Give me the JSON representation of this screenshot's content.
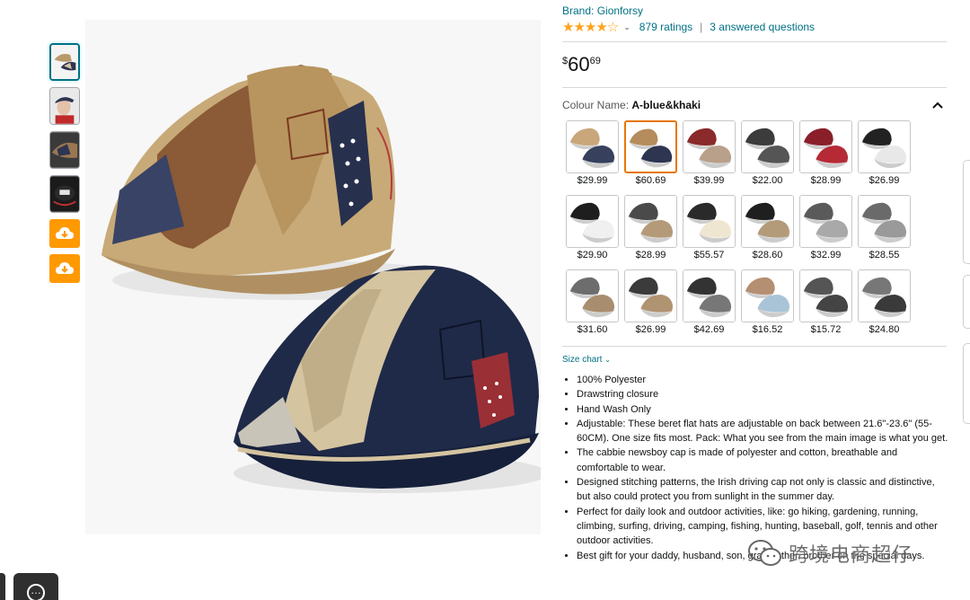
{
  "thumbnails": [
    {
      "icon": "cap-pair-thumbnail",
      "selected": true
    },
    {
      "icon": "model-wearing-cap-thumbnail"
    },
    {
      "icon": "cap-detail-thumbnail"
    },
    {
      "icon": "cap-inner-label-thumbnail"
    }
  ],
  "download_buttons": [
    {
      "icon": "cloud-download-icon"
    },
    {
      "icon": "cloud-download-icon"
    }
  ],
  "brand": "Brand: Gionforsy",
  "rating": {
    "stars": "★★★★☆",
    "ratings": "879 ratings",
    "separator": "|",
    "questions": "3 answered questions"
  },
  "price": {
    "symbol": "$",
    "whole": "60",
    "fraction": "69"
  },
  "colour": {
    "label": "Colour Name: ",
    "value": "A-blue&khaki"
  },
  "swatches": [
    {
      "price": "$29.99",
      "colors": [
        "#c9a77b",
        "#37405c"
      ]
    },
    {
      "price": "$60.69",
      "colors": [
        "#b58d5c",
        "#2d3550"
      ],
      "selected": true
    },
    {
      "price": "$39.99",
      "colors": [
        "#8a2a2a",
        "#b8a08a"
      ]
    },
    {
      "price": "$22.00",
      "colors": [
        "#3c3c3c",
        "#555555"
      ]
    },
    {
      "price": "$28.99",
      "colors": [
        "#8a1f2a",
        "#b52a35"
      ]
    },
    {
      "price": "$26.99",
      "colors": [
        "#222222",
        "#e8e8e8"
      ]
    },
    {
      "price": "$29.90",
      "colors": [
        "#1e1e1e",
        "#f0f0f0"
      ]
    },
    {
      "price": "$28.99",
      "colors": [
        "#4a4a4a",
        "#b49a78"
      ]
    },
    {
      "price": "$55.57",
      "colors": [
        "#2a2a2a",
        "#efe6d2"
      ]
    },
    {
      "price": "$28.60",
      "colors": [
        "#1f1f1f",
        "#b39b7a"
      ]
    },
    {
      "price": "$32.99",
      "colors": [
        "#5a5a5a",
        "#a9a9a9"
      ]
    },
    {
      "price": "$28.55",
      "colors": [
        "#6a6a6a",
        "#9a9a9a"
      ]
    },
    {
      "price": "$31.60",
      "colors": [
        "#6d6d6d",
        "#a88e6e"
      ]
    },
    {
      "price": "$26.99",
      "colors": [
        "#3b3b3b",
        "#b09371"
      ]
    },
    {
      "price": "$42.69",
      "colors": [
        "#333333",
        "#777777"
      ]
    },
    {
      "price": "$16.52",
      "colors": [
        "#b58f72",
        "#a9c4d6"
      ]
    },
    {
      "price": "$15.72",
      "colors": [
        "#555555",
        "#444444"
      ]
    },
    {
      "price": "$24.80",
      "colors": [
        "#777777",
        "#3a3a3a"
      ]
    }
  ],
  "size_chart": "Size chart",
  "bullets": [
    "100% Polyester",
    "Drawstring closure",
    "Hand Wash Only",
    "Adjustable: These beret flat hats are adjustable on back between 21.6\"-23.6\" (55-60CM). One size fits most. Pack: What you see from the main image is what you get.",
    "The cabbie newsboy cap is made of polyester and cotton, breathable and comfortable to wear.",
    "Designed stitching patterns, the Irish driving cap not only is classic and distinctive, but also could protect you from sunlight in the summer day.",
    "Perfect for daily look and outdoor activities, like: go hiking, gardening, running, climbing, surfing, driving, camping, fishing, hunting, baseball, golf, tennis and other outdoor activities.",
    "Best gift for your daddy, husband, son, grandfather, brother on the special days."
  ],
  "watermark": "跨境电商超仔",
  "colors": {
    "link": "#007185",
    "star": "#ffa41c",
    "orange": "#ff9900",
    "selected_swatch": "#e77600"
  }
}
